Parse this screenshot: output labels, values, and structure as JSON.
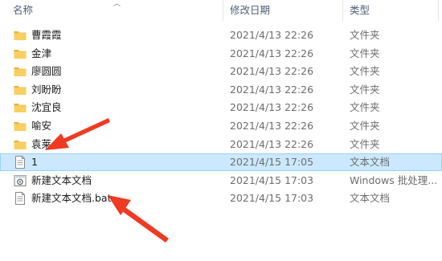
{
  "columns": {
    "name": "名称",
    "modified": "修改日期",
    "type": "类型"
  },
  "files": [
    {
      "name": "曹霞霞",
      "modified": "2021/4/13 22:26",
      "type": "文件夹",
      "icon": "folder-icon"
    },
    {
      "name": "金津",
      "modified": "2021/4/13 22:26",
      "type": "文件夹",
      "icon": "folder-icon"
    },
    {
      "name": "廖圆圆",
      "modified": "2021/4/13 22:26",
      "type": "文件夹",
      "icon": "folder-icon"
    },
    {
      "name": "刘盼盼",
      "modified": "2021/4/13 22:26",
      "type": "文件夹",
      "icon": "folder-icon"
    },
    {
      "name": "沈宜良",
      "modified": "2021/4/13 22:26",
      "type": "文件夹",
      "icon": "folder-icon"
    },
    {
      "name": "喻安",
      "modified": "2021/4/13 22:26",
      "type": "文件夹",
      "icon": "folder-icon"
    },
    {
      "name": "袁莱",
      "modified": "2021/4/13 22:26",
      "type": "文件夹",
      "icon": "folder-icon"
    },
    {
      "name": "1",
      "modified": "2021/4/15 17:05",
      "type": "文本文档",
      "icon": "text-document-icon",
      "selected": true
    },
    {
      "name": "新建文本文档",
      "modified": "2021/4/15 17:03",
      "type": "Windows 批处理...",
      "icon": "batch-file-icon"
    },
    {
      "name": "新建文本文档.bat",
      "modified": "2021/4/15 17:03",
      "type": "文本文档",
      "icon": "text-document-icon"
    }
  ],
  "colors": {
    "folder": "#f6c85a",
    "selection": "#cce8ff",
    "annotation_arrow": "#f03a22"
  }
}
